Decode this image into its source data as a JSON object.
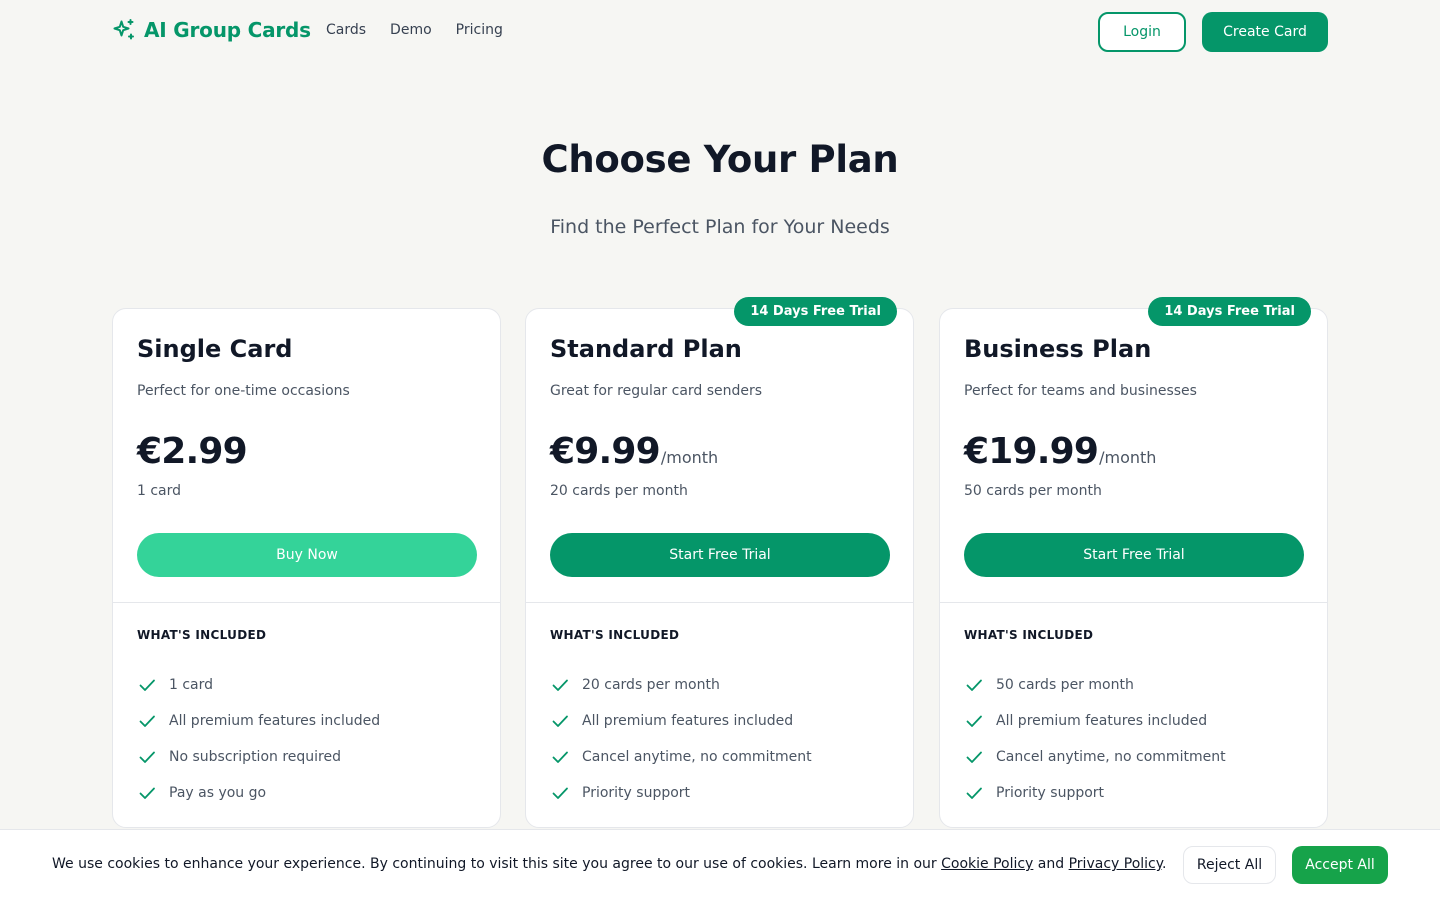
{
  "brand": {
    "name": "AI Group Cards",
    "icon": "sparkles-icon",
    "color": "#059669"
  },
  "nav": {
    "links": [
      "Cards",
      "Demo",
      "Pricing"
    ],
    "login_label": "Login",
    "create_label": "Create Card"
  },
  "hero": {
    "title": "Choose Your Plan",
    "subtitle": "Find the Perfect Plan for Your Needs"
  },
  "plans": [
    {
      "name": "Single Card",
      "description": "Perfect for one-time occasions",
      "price": "€2.99",
      "period": "",
      "quota": "1 card",
      "cta": "Buy Now",
      "badge": "",
      "included_heading": "WHAT'S INCLUDED",
      "features": [
        "1 card",
        "All premium features included",
        "No subscription required",
        "Pay as you go"
      ]
    },
    {
      "name": "Standard Plan",
      "description": "Great for regular card senders",
      "price": "€9.99",
      "period": "/month",
      "quota": "20 cards per month",
      "cta": "Start Free Trial",
      "badge": "14 Days Free Trial",
      "included_heading": "WHAT'S INCLUDED",
      "features": [
        "20 cards per month",
        "All premium features included",
        "Cancel anytime, no commitment",
        "Priority support"
      ]
    },
    {
      "name": "Business Plan",
      "description": "Perfect for teams and businesses",
      "price": "€19.99",
      "period": "/month",
      "quota": "50 cards per month",
      "cta": "Start Free Trial",
      "badge": "14 Days Free Trial",
      "included_heading": "WHAT'S INCLUDED",
      "features": [
        "50 cards per month",
        "All premium features included",
        "Cancel anytime, no commitment",
        "Priority support"
      ]
    }
  ],
  "cookie": {
    "text": "We use cookies to enhance your experience. By continuing to visit this site you agree to our use of cookies. Learn more in our ",
    "cookie_policy": "Cookie Policy",
    "and": " and ",
    "privacy_policy": "Privacy Policy",
    "end": ".",
    "reject_label": "Reject All",
    "accept_label": "Accept All"
  },
  "colors": {
    "primary": "#059669",
    "primary_light": "#34d399",
    "accept": "#16a34a",
    "background": "#f6f6f3"
  }
}
